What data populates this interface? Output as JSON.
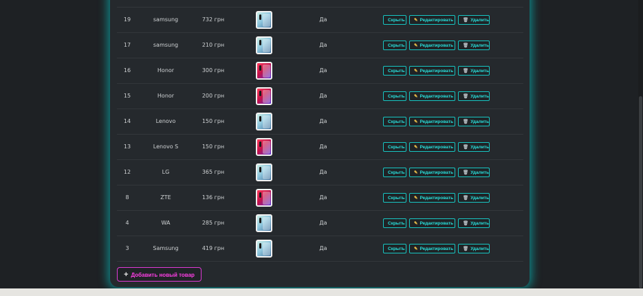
{
  "rows": [
    {
      "id": "19",
      "name": "samsung",
      "price": "732 грн",
      "phone": "cool",
      "status": "Да"
    },
    {
      "id": "17",
      "name": "samsung",
      "price": "210 грн",
      "phone": "cool",
      "status": "Да"
    },
    {
      "id": "16",
      "name": "Honor",
      "price": "300 грн",
      "phone": "warm",
      "status": "Да"
    },
    {
      "id": "15",
      "name": "Honor",
      "price": "200 грн",
      "phone": "warm",
      "status": "Да"
    },
    {
      "id": "14",
      "name": "Lenovo",
      "price": "150 грн",
      "phone": "cool",
      "status": "Да"
    },
    {
      "id": "13",
      "name": "Lenovo S",
      "price": "150 грн",
      "phone": "warm",
      "status": "Да"
    },
    {
      "id": "12",
      "name": "LG",
      "price": "365 грн",
      "phone": "cool",
      "status": "Да"
    },
    {
      "id": "8",
      "name": "ZTE",
      "price": "136 грн",
      "phone": "warm",
      "status": "Да"
    },
    {
      "id": "4",
      "name": "WA",
      "price": "285 грн",
      "phone": "cool",
      "status": "Да"
    },
    {
      "id": "3",
      "name": "Samsung",
      "price": "419 грн",
      "phone": "cool",
      "status": "Да"
    }
  ],
  "actions": {
    "hide_label": "Скрыть",
    "edit_label": "Редактировать",
    "delete_label": "Удалить"
  },
  "add_button": {
    "label": "Добавить новый товар"
  },
  "icons": {
    "edit": "pencil-icon",
    "delete": "trash-icon",
    "add": "plus-icon",
    "product": "phone-image"
  },
  "colors": {
    "accent": "#28e0dc",
    "add_accent": "#ff3fe6",
    "panel": "#25292d",
    "background": "#1e2124"
  }
}
